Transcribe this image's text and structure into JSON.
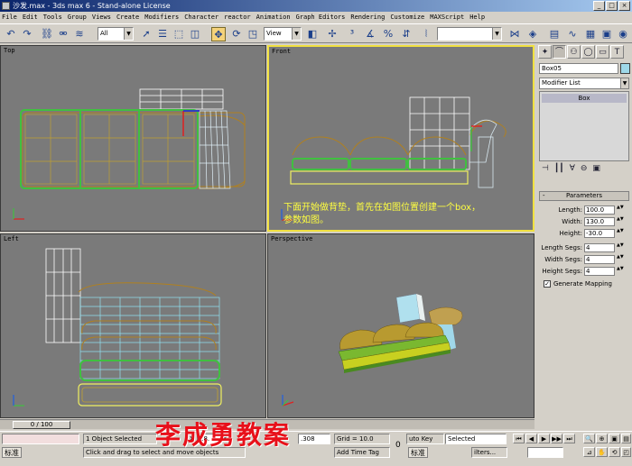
{
  "titlebar": {
    "title": "沙发.max - 3ds max 6 - Stand-alone License",
    "min": "_",
    "max": "□",
    "close": "×"
  },
  "menu": [
    "File",
    "Edit",
    "Tools",
    "Group",
    "Views",
    "Create",
    "Modifiers",
    "Character",
    "reactor",
    "Animation",
    "Graph Editors",
    "Rendering",
    "Customize",
    "MAXScript",
    "Help"
  ],
  "toolbar": {
    "selection_filter": "All",
    "ref_coord": "View",
    "named_sel": ""
  },
  "viewports": {
    "top": {
      "label": "Top"
    },
    "front": {
      "label": "Front",
      "instruction_line1": "下面开始做背垫，首先在如图位置创建一个box，",
      "instruction_line2": "参数如图。"
    },
    "left": {
      "label": "Left"
    },
    "perspective": {
      "label": "Perspective"
    }
  },
  "command_panel": {
    "object_name": "Box05",
    "object_color": "#9ed8e8",
    "modifier_list": "Modifier List",
    "stack_item": "Box",
    "rollout_title": "Parameters",
    "params": [
      {
        "label": "Length:",
        "value": "100.0"
      },
      {
        "label": "Width:",
        "value": "130.0"
      },
      {
        "label": "Height:",
        "value": "-30.0"
      },
      {
        "label": "Length Segs:",
        "value": "4"
      },
      {
        "label": "Width Segs:",
        "value": "4"
      },
      {
        "label": "Height Segs:",
        "value": "4"
      }
    ],
    "generate_mapping": "Generate Mapping",
    "generate_mapping_checked": true
  },
  "timeslider": {
    "frame": "0 / 100"
  },
  "status": {
    "selected": "1 Object Selected",
    "prompt": "Click and drag to select and move objects",
    "x_label": "X",
    "x_value": "28.",
    "y_label": "Y",
    "z_value": ".308",
    "grid": "Grid = 10.0",
    "add_time_tag": "Add Time Tag",
    "auto_key": "uto Key",
    "selected_combo": "Selected",
    "key_filters": "ilters...",
    "frame_value": "0",
    "lang": "标准",
    "lang2": "标准"
  },
  "watermark": "李成勇教案"
}
